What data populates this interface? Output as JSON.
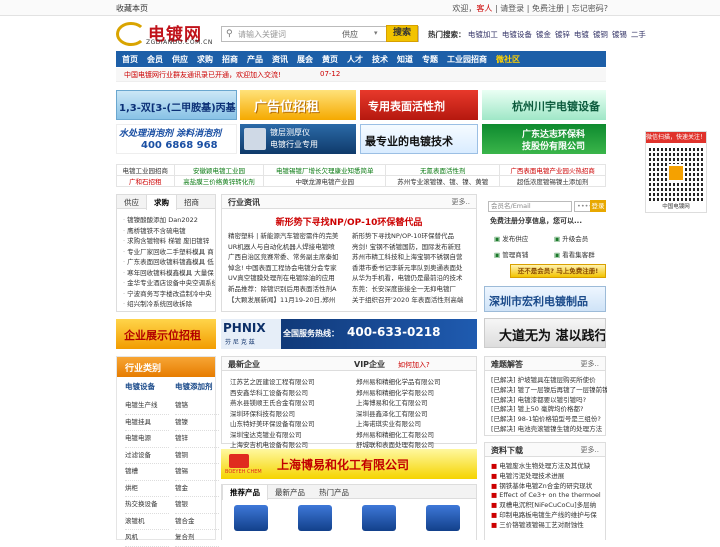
{
  "topbar": {
    "bookmark": "收藏本页",
    "welcome": "欢迎，",
    "guest": "客人",
    "links": " | 请登录 | 免费注册 | 忘记密码?"
  },
  "logo": {
    "title": "电镀网",
    "domain": "ZGDIANDU.COM.CN"
  },
  "search": {
    "placeholder": "请输入关键词",
    "category": "供应",
    "button": "搜索"
  },
  "hot": {
    "label": "热门搜索：",
    "items": [
      "电镀加工",
      "电镀设备",
      "镀金",
      "镀锌",
      "电镀",
      "镀铜",
      "镀锡",
      "二手"
    ]
  },
  "nav": {
    "items": [
      "首页",
      "会员",
      "供应",
      "求购",
      "招商",
      "产品",
      "资讯",
      "展会",
      "黄页",
      "人才",
      "技术",
      "知道",
      "专题",
      "工业园招商",
      "微社区"
    ]
  },
  "notice": {
    "message": "中国电镀网行业群友通讯录已开通，欢迎加入交流!",
    "date": "07-12"
  },
  "banners": {
    "b1": "1,3-双[3-(二甲胺基)丙基]脲",
    "b2": "广告位招租",
    "b3": "专用表面活性剂",
    "b4": "杭州川宇电镀设备",
    "b5a": "水处理消泡剂 涂料消泡剂",
    "b5b": "400 6868 968",
    "b6a": "镀层测厚仪",
    "b6b": "电镀行业专用",
    "b7": "最专业的电镀技术",
    "b8a": "广东达志环保科",
    "b8b": "技股份有限公司"
  },
  "qr": {
    "header": "微信扫描，快速关注！",
    "caption": "中国电镀网"
  },
  "links": {
    "row1": [
      "电镀工业园招商",
      "安徽颖电镀工业园",
      "电镀锡镀厂增长欠理康业知悉简单",
      "无氰表面活性剂",
      "广西表面电镀产业园火热招商"
    ],
    "row2": [
      "广和石招租",
      "高盐膜三价络黄锌转化剂",
      "中联龙源电镀产业园",
      "苏州专业滚镀镍、镀、镍、黄镀",
      "超低浓度镀锡镍土添加剂"
    ]
  },
  "supply": {
    "tabs": [
      "供应",
      "求购",
      "招商"
    ],
    "items": [
      "镀镍酸酸添加 Dan2022",
      "鹰桥镀铁不含硫电镀",
      "求购含镀物料 梯镀 废旧镀锌",
      "专业厂家回收二手塑料模具 商",
      "广东表面回收镀料镀鑫模具 低",
      "寒年回收镀料模鑫模具 大量保",
      "金华专业酒店设备中央空调系统",
      "宁波商务写字楼改造制冷中央",
      "绍兴制冷系统回收拆除"
    ]
  },
  "news": {
    "title": "行业资讯",
    "more": "更多..",
    "headline": "新形势下寻找NP/OP-10环保替代品",
    "left": [
      "精密塑料 | 新能源汽车镀密需件的完美",
      "UR机器人与自动化机器人焊接电镀喷",
      "广西自治区竞赛常委、常务副主席秦如",
      "悼念! 中国表面工程协会电镀分会专家",
      "UV真空镀膜处理剂在电镀除油的应用",
      "新品推荐：除镀识别后用表面活性剂A",
      "【大颗发展新闻】11月19-20日,郑州"
    ],
    "right": [
      "新形势下寻找NP/OP-10环保替代品",
      "亮剑! 宝钢不锈镀国防，国际发布新冠",
      "苏州市精工科技和上海宝钢不锈钢自营",
      "香港市委书记李新元率队到奥通表面处",
      "从华为手机看，电镀仍是最前沿的技术",
      "东莞：长安深度嵌接全一无抑电镀厂",
      "关于组织召开'2020 年表面活性剂高端",
      "SF EXPO盛世推广进驻各个工业园区"
    ]
  },
  "login": {
    "user_placeholder": "会员名/Email",
    "pass_placeholder": "••••••",
    "go": "登录",
    "message": "免费注册分享信息，您可以...",
    "ops": [
      "发布供应",
      "升级会员",
      "管理商铺",
      "看看集客群"
    ],
    "register": "还不是会员? 马上免费注册!"
  },
  "ads": {
    "ad1": "深圳市宏利电镀制品",
    "ad2": "大道无为 湛以践行",
    "ad3": "企业展示位招租",
    "ad4_brand": "PHNIX",
    "ad4_brand_sub": "芬 尼 克 兹",
    "ad4_tag": "全国服务热线：",
    "ad4_phone": "400-633-0218",
    "ad5": "上海博易和化工有限公司",
    "ad5_sub": "BOEYEH CHEM"
  },
  "industry": {
    "title": "行业类别",
    "g1": "电镀设备",
    "g2": "电镀添加剂",
    "c1": [
      "电镀生产线",
      "电镀挂具",
      "电镀电源",
      "过滤设备",
      "镀槽",
      "烘柜",
      "热交换设备",
      "滚镀机",
      "风机"
    ],
    "c2": [
      "镀铬",
      "镀镍",
      "镀锌",
      "镀铜",
      "镀锡",
      "镀金",
      "镀银",
      "镀合金",
      "复合剂"
    ]
  },
  "enterprises": {
    "new_title": "最新企业",
    "vip_title": "VIP企业",
    "join": "如何加入?",
    "left": [
      "江苏艺之匠建设工程有限公司",
      "西安鑫华科工设备有限公司",
      "燕水县镁顺王氏合金有限公司",
      "深圳环保科技有限公司",
      "山东特好美环保设备有限公司",
      "深圳宝达克镀业有限公司",
      "上海安吉机电设备有限公司"
    ],
    "right": [
      "郑州易和精细化学品有限公司",
      "郑州易和精细化学有限公司",
      "上海博易和化工有限公司",
      "深圳县鑫泽化工有限公司",
      "上海诺琪实业有限公司",
      "郑州易和精细化工有限公司",
      "舒城联和表面处理有限公司"
    ]
  },
  "products": {
    "tabs": [
      "推荐产品",
      "最新产品",
      "热门产品"
    ]
  },
  "qa": {
    "title": "难题解答",
    "more": "更多..",
    "items": [
      "[已解决]  护坡镀具在镀层购买所使价",
      "[已解决]  镀了一层镍后再镀了一层镍前镍",
      "[已解决]  电镀漆都要以镀引镀吗?",
      "[已解决]  镀上50 毫牌均价格都?",
      "[已解决]  98-1铂价格铂型号是三组份?",
      "[已解决]  电池壳滚镀镍生镀的处理方法"
    ]
  },
  "materials": {
    "title": "资料下载",
    "more": "更多..",
    "items": [
      "电镀废水生物处理方法及其优缺",
      "电镀污泥处理技术进展",
      "钢铁基体电镀Zn合金的研究现状",
      "Effect of Ce3+ on the thermoel",
      "双槽电沉积[NiFeCuCoCu]多层纳",
      "印制电路板电镀生产线的维护与保",
      "三价铬镀液镀锡工艺对耐蚀性"
    ]
  }
}
